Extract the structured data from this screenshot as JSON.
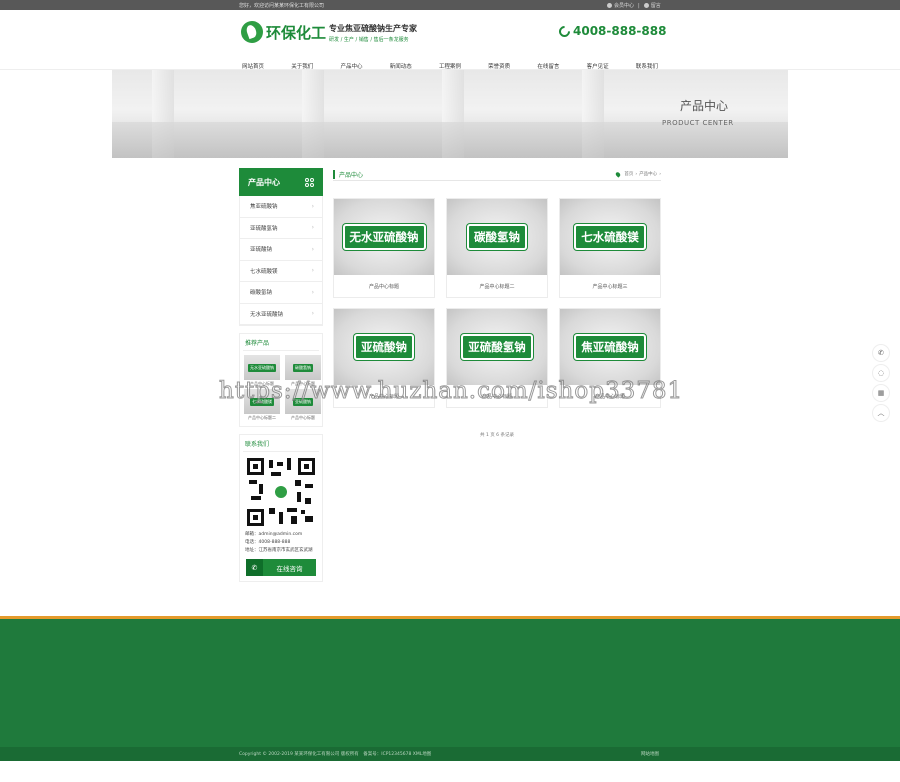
{
  "topbar": {
    "welcome": "您好，欢迎访问某某环保化工有限公司",
    "member": "会员中心",
    "message": "留言"
  },
  "header": {
    "logo_text": "环保化工",
    "slogan_main": "专业焦亚硫酸钠生产专家",
    "slogan_sub": "研发 / 生产 / 销售 / 售后一条龙服务",
    "phone": "4008-888-888"
  },
  "nav": [
    "网站首页",
    "关于我们",
    "产品中心",
    "新闻动态",
    "工程案例",
    "荣誉资质",
    "在线留言",
    "客户见证",
    "联系我们"
  ],
  "banner": {
    "title_cn": "产品中心",
    "title_en": "PRODUCT CENTER"
  },
  "sidebar": {
    "title": "产品中心",
    "categories": [
      "焦亚硫酸钠",
      "亚硫酸氢钠",
      "亚硫酸钠",
      "七水硫酸镁",
      "碳酸氢钠",
      "无水亚硫酸钠"
    ],
    "hot_title": "推荐产品",
    "hot_items": [
      {
        "badge": "无水亚硫酸钠",
        "caption": "产品中心标题"
      },
      {
        "badge": "碳酸氢钠",
        "caption": "产品中心标题"
      },
      {
        "badge": "七水硫酸镁",
        "caption": "产品中心标题二"
      },
      {
        "badge": "亚硫酸钠",
        "caption": "产品中心标题"
      }
    ],
    "contact_title": "联系我们",
    "email": "邮箱：admin@admin.com",
    "tel": "电话：4008-888-888",
    "address": "地址：江苏省南京市玄武区玄武湖",
    "online_btn": "在线咨询"
  },
  "main": {
    "title": "产品中心",
    "crumb_home": "首页",
    "crumb_sep": "›",
    "crumb_current": "产品中心",
    "products": [
      {
        "label": "无水亚硫酸钠",
        "caption": "产品中心标题"
      },
      {
        "label": "碳酸氢钠",
        "caption": "产品中心标题二"
      },
      {
        "label": "七水硫酸镁",
        "caption": "产品中心标题三"
      },
      {
        "label": "亚硫酸钠",
        "caption": "产品中心标题"
      },
      {
        "label": "亚硫酸氢钠",
        "caption": "产品中心标题"
      },
      {
        "label": "焦亚硫酸钠",
        "caption": "产品中心标题"
      }
    ],
    "pager": "共 1 页 6 条记录"
  },
  "watermark": "https://www.huzhan.com/ishop33781",
  "footer": {
    "copyright": "Copyright © 2002-2019 某某环保化工有限公司 版权所有　备案号：ICP12345678 XML地图",
    "sitemap": "网站地图"
  },
  "colors": {
    "brand_green": "#1e8b3a",
    "footer_green": "#1f7a3c",
    "accent_orange": "#e49b2b"
  }
}
